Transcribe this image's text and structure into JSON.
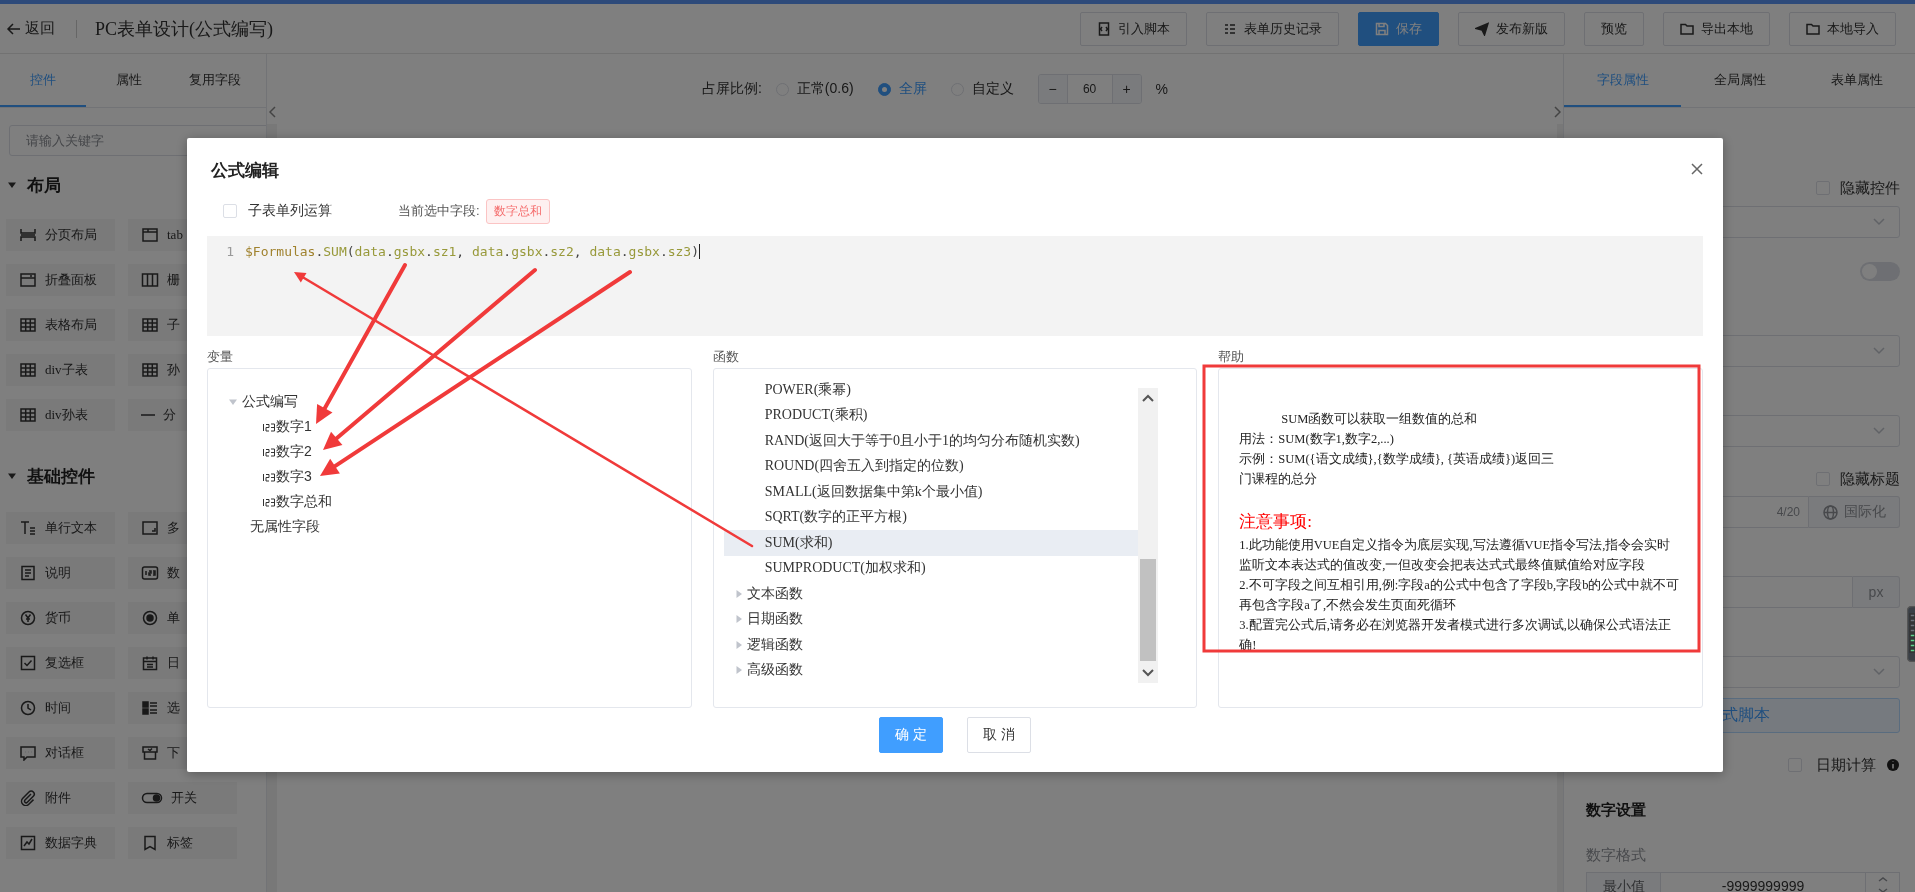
{
  "top_bar": {
    "back_label": "返回",
    "title": "PC表单设计(公式编写)",
    "buttons": [
      {
        "label": "引入脚本",
        "primary": false
      },
      {
        "label": "表单历史记录",
        "primary": false
      },
      {
        "label": "保存",
        "primary": true
      },
      {
        "label": "发布新版",
        "primary": false
      },
      {
        "label": "预览",
        "primary": false
      },
      {
        "label": "导出本地",
        "primary": false
      },
      {
        "label": "本地导入",
        "primary": false
      }
    ]
  },
  "left_panel": {
    "tabs": [
      {
        "label": "控件",
        "selected": true
      },
      {
        "label": "属性",
        "selected": false
      },
      {
        "label": "复用字段",
        "selected": false
      }
    ],
    "search": {
      "placeholder": "请输入关键字"
    },
    "sections": [
      {
        "title": "布局",
        "expanded": true,
        "items": [
          "分页布局",
          "tab",
          "折叠面板",
          "栅",
          "表格布局",
          "子",
          "div子表",
          "孙",
          "div孙表",
          "分"
        ]
      },
      {
        "title": "基础控件",
        "expanded": true,
        "items": [
          "单行文本",
          "多",
          "说明",
          "数",
          "货币",
          "单",
          "复选框",
          "日",
          "时间",
          "选",
          "对话框",
          "下",
          "附件",
          "开关",
          "数据字典",
          "标签"
        ]
      }
    ]
  },
  "canvas": {
    "ratio_label": "占屏比例:",
    "ratio_options": [
      {
        "label": "正常(0.6)",
        "selected": false
      },
      {
        "label": "全屏",
        "selected": true
      },
      {
        "label": "自定义",
        "selected": false
      }
    ],
    "minus": "−",
    "value": "60",
    "plus": "+",
    "unit": "%"
  },
  "right_panel": {
    "tabs": [
      {
        "label": "字段属性",
        "selected": true
      },
      {
        "label": "全局属性",
        "selected": false
      },
      {
        "label": "表单属性",
        "selected": false
      }
    ],
    "fields": [
      {
        "kind": "checkbox",
        "label": "隐藏控件",
        "checked": false
      },
      {
        "kind": "select"
      },
      {
        "kind": "switch",
        "on": false
      },
      {
        "kind": "select"
      },
      {
        "kind": "select"
      },
      {
        "kind": "checkbox",
        "label": "隐藏标题",
        "checked": false
      },
      {
        "kind": "counter_input",
        "counter": "4/20",
        "button": "国际化"
      },
      {
        "kind": "suffix_input",
        "suffix": "px"
      },
      {
        "kind": "select"
      },
      {
        "kind": "script_button",
        "label": "式脚本"
      },
      {
        "kind": "checkbox_info",
        "label": "日期计算",
        "checked": false
      },
      {
        "kind": "heading",
        "label": "数字设置"
      },
      {
        "kind": "caption",
        "label": "数字格式"
      },
      {
        "kind": "number_range",
        "prefix": "最小值",
        "value": "-9999999999"
      }
    ]
  },
  "dialog": {
    "title": "公式编辑",
    "subtable_checkbox": {
      "label": "子表单列运算",
      "checked": false
    },
    "current_field_label": "当前选中字段:",
    "current_field": "数字总和",
    "editor": {
      "line_number": "1",
      "code": "$Formulas.SUM(data.gsbx.sz1, data.gsbx.sz2, data.gsbx.sz3)"
    },
    "variables": {
      "title": "变量",
      "tree": [
        {
          "kind": "group",
          "label": "公式编写",
          "expanded": true,
          "children": [
            {
              "kind": "number",
              "label": "数字1"
            },
            {
              "kind": "number",
              "label": "数字2"
            },
            {
              "kind": "number",
              "label": "数字3"
            },
            {
              "kind": "number",
              "label": "数字总和"
            }
          ]
        },
        {
          "kind": "plain",
          "label": "无属性字段"
        }
      ]
    },
    "functions": {
      "title": "函数",
      "items": [
        {
          "kind": "function",
          "label": "POWER(乘幂)",
          "selected": false
        },
        {
          "kind": "function",
          "label": "PRODUCT(乘积)",
          "selected": false
        },
        {
          "kind": "function",
          "label": "RAND(返回大于等于0且小于1的均匀分布随机实数)",
          "selected": false
        },
        {
          "kind": "function",
          "label": "ROUND(四舍五入到指定的位数)",
          "selected": false
        },
        {
          "kind": "function",
          "label": "SMALL(返回数据集中第k个最小值)",
          "selected": false
        },
        {
          "kind": "function",
          "label": "SQRT(数字的正平方根)",
          "selected": false
        },
        {
          "kind": "function",
          "label": "SUM(求和)",
          "selected": true
        },
        {
          "kind": "function",
          "label": "SUMPRODUCT(加权求和)",
          "selected": false
        },
        {
          "kind": "category",
          "label": "文本函数",
          "expanded": false
        },
        {
          "kind": "category",
          "label": "日期函数",
          "expanded": false
        },
        {
          "kind": "category",
          "label": "逻辑函数",
          "expanded": false
        },
        {
          "kind": "category",
          "label": "高级函数",
          "expanded": false
        }
      ]
    },
    "help": {
      "title": "帮助",
      "summary": "SUM函数可以获取一组数值的总和",
      "usage": "用法：SUM(数字1,数字2,...)",
      "example": "示例：SUM({语文成绩},{数学成绩}, {英语成绩})返回三门课程的总分",
      "notes_title": "注意事项:",
      "notes": [
        "1.此功能使用VUE自定义指令为底层实现,写法遵循VUE指令写法,指令会实时监听文本表达式的值改变,一但改变会把表达式式最终值赋值给对应字段",
        "2.不可字段之间互相引用,例:字段a的公式中包含了字段b,字段b的公式中就不可再包含字段a了,不然会发生页面死循环",
        "3.配置完公式后,请务必在浏览器开发者模式进行多次调试,以确保公式语法正确!"
      ]
    },
    "buttons": [
      {
        "label": "确 定",
        "primary": true
      },
      {
        "label": "取 消",
        "primary": false
      }
    ]
  }
}
